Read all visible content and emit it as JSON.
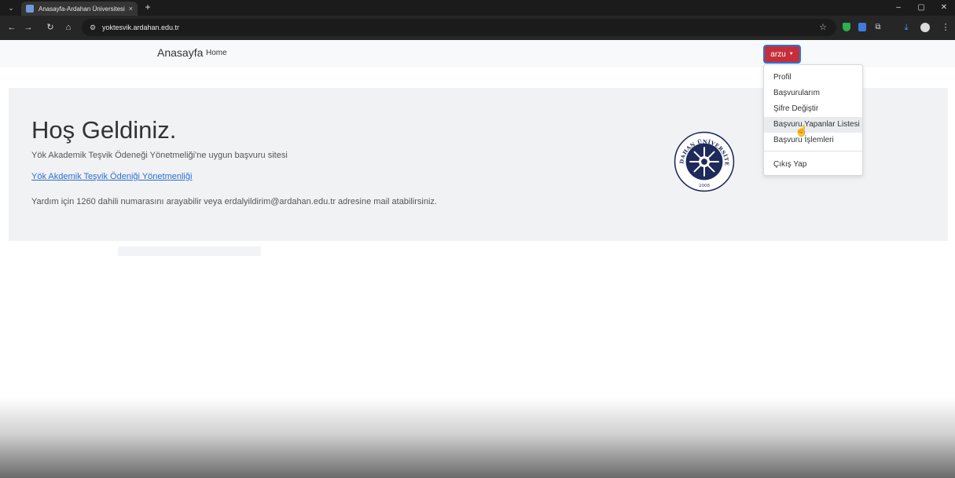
{
  "browser": {
    "tab_title": "Anasayfa-Ardahan Üniversitesi",
    "tab_close": "×",
    "new_tab": "+",
    "url": "yoktesvik.ardahan.edu.tr"
  },
  "icons": {
    "tab_menu": "chevron-down-icon",
    "back": "back-arrow-icon",
    "forward": "forward-arrow-icon",
    "reload": "reload-icon",
    "home": "home-icon",
    "site_info": "site-info-icon",
    "bookmark": "star-icon",
    "minimize": "minimize-icon",
    "restore": "restore-icon",
    "close": "close-icon"
  },
  "navbar": {
    "brand": "Anasayfa",
    "home": "Home",
    "user": "arzu"
  },
  "dropdown": {
    "items": [
      "Profil",
      "Başvurularım",
      "Şifre Değiştir",
      "Başvuru Yapanlar Listesi",
      "Başvuru İşlemleri",
      "Çıkış Yap"
    ],
    "hovered_index": 3
  },
  "jumbotron": {
    "title": "Hoş Geldiniz.",
    "lead": "Yök Akademik Teşvik Ödeneği Yönetmeliği'ne uygun başvuru sitesi",
    "link": "Yök Akdemik Teşvik Ödeniği Yönetmenliği",
    "help": "Yardım için 1260 dahili numarasını arayabilir veya erdalyildirim@ardahan.edu.tr adresine mail atabilirsiniz."
  },
  "seal": {
    "text_top": "ARDAHAN ÜNİVERSİTESİ",
    "year": "2008"
  },
  "colors": {
    "user_button": "#c52f3a",
    "link": "#2b6fd1",
    "seal_navy": "#1e2a5a"
  }
}
